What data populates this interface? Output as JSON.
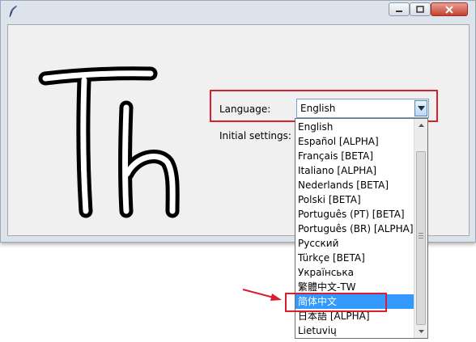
{
  "window": {
    "controls": {
      "minimize_icon": "minimize-icon",
      "maximize_icon": "maximize-icon",
      "close_icon": "close-icon"
    },
    "colors": {
      "close": "#c6402f",
      "frame": "#dde3ea"
    }
  },
  "form": {
    "language_label": "Language:",
    "initial_settings_label": "Initial settings:",
    "language_value": "English"
  },
  "dropdown": {
    "options": [
      "English",
      "Español [ALPHA]",
      "Français [BETA]",
      "Italiano [ALPHA]",
      "Nederlands [BETA]",
      "Polski [BETA]",
      "Português (PT) [BETA]",
      "Português (BR) [ALPHA]",
      "Русский",
      "Türkçe [BETA]",
      "Українська",
      "繁體中文-TW",
      "简体中文",
      "日本語 [ALPHA]",
      "Lietuvių"
    ],
    "selected_index": 12
  },
  "annotations": {
    "highlight_color": "#d71f2f",
    "selection_color": "#3399ff"
  }
}
